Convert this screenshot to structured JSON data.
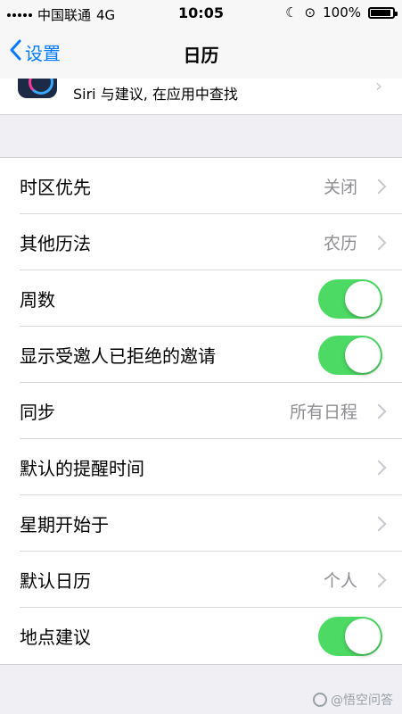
{
  "status_bar": {
    "carrier": "中国联通",
    "network": "4G",
    "time": "10:05",
    "battery": "100%"
  },
  "nav": {
    "back_label": "设置",
    "title": "日历"
  },
  "siri_row": {
    "text": "Siri 与建议, 在应用中查找"
  },
  "rows": [
    {
      "label": "时区优先",
      "value": "关闭"
    },
    {
      "label": "其他历法",
      "value": "农历"
    },
    {
      "label": "周数",
      "toggle": true
    },
    {
      "label": "显示受邀人已拒绝的邀请",
      "toggle": true
    },
    {
      "label": "同步",
      "value": "所有日程"
    },
    {
      "label": "默认的提醒时间",
      "value": ""
    },
    {
      "label": "星期开始于",
      "value": ""
    },
    {
      "label": "默认日历",
      "value": "个人"
    },
    {
      "label": "地点建议",
      "toggle": true
    }
  ],
  "watermark": "@悟空问答",
  "colors": {
    "accent": "#007aff",
    "toggle_on": "#4cd964",
    "background": "#efeff4"
  }
}
